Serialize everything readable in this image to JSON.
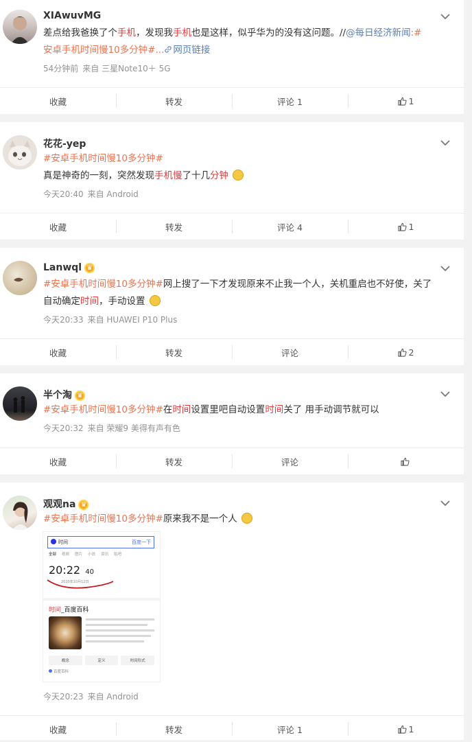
{
  "posts": [
    {
      "user": "XIAwuvMG",
      "text1_pre": "差点给我爸换了个",
      "text1_hl1": "手机",
      "text1_mid": "，发现我",
      "text1_hl2": "手机",
      "text1_post": "也是这样，似乎华为的没有这问题。//",
      "mention": "@每日经济新闻",
      "colon": ":#",
      "tag2": "安卓手机时间慢10多分钟",
      "tag2_end": "#...",
      "weblink": "网页链接",
      "time": "54分钟前",
      "source": "来自 三星Note10＋ 5G",
      "collect": "收藏",
      "repost": "转发",
      "comment": "评论 1",
      "like": "1"
    },
    {
      "user": "花花-yep",
      "tag": "#安卓手机时间慢10多分钟#",
      "line2_pre": "真是神奇的一刻，突然发现",
      "line2_hl1": "手机慢",
      "line2_mid": "了十几",
      "line2_hl2": "分钟",
      "time": "今天20:40",
      "source": "来自 Android",
      "collect": "收藏",
      "repost": "转发",
      "comment": "评论 4",
      "like": "1"
    },
    {
      "user": "Lanwql",
      "tag": "#安卓手机时间慢10多分钟#",
      "text_a": "网上搜了一下才发现原来不止我一个人，关机重启也不好使，关了",
      "text_b_pre": "自动确定",
      "text_b_hl": "时间",
      "text_b_post": "，手动设置",
      "time": "今天20:33",
      "source": "来自 HUAWEI P10 Plus",
      "collect": "收藏",
      "repost": "转发",
      "comment": "评论",
      "like": "2"
    },
    {
      "user": "半个淘",
      "tag": "#安卓手机时间慢10多分钟#",
      "t1": "在",
      "t1_hl": "时间",
      "t2": "设置里吧自动设置",
      "t2_hl": "时间",
      "t3": "关了 用手动调节就可以",
      "time": "今天20:32",
      "source": "来自 荣耀9 美得有声有色",
      "collect": "收藏",
      "repost": "转发",
      "comment": "评论",
      "like": ""
    },
    {
      "user": "观观na",
      "tag": "#安卓手机时间慢10多分钟#",
      "text": "原来我不是一个人",
      "time": "今天20:23",
      "source": "来自 Android",
      "collect": "收藏",
      "repost": "转发",
      "comment": "评论 1",
      "like": "1",
      "shot": {
        "query": "时间",
        "search_btn": "百度一下",
        "tabs": [
          "全部",
          "视频",
          "图片",
          "小说",
          "资讯",
          "贴吧"
        ],
        "clock": "20:22",
        "seconds": "40",
        "date": "2020年10月12日",
        "baike_hl": "时间",
        "baike_title": "_百度百科",
        "baike_btn1": "概念",
        "baike_btn2": "定义",
        "baike_btn3": "时间形式",
        "baike_src": "百度百科"
      }
    }
  ],
  "colors": {
    "highlight": "#e4393c",
    "topic": "#eb7350",
    "link": "#5b7fb5",
    "meta": "#939393"
  }
}
